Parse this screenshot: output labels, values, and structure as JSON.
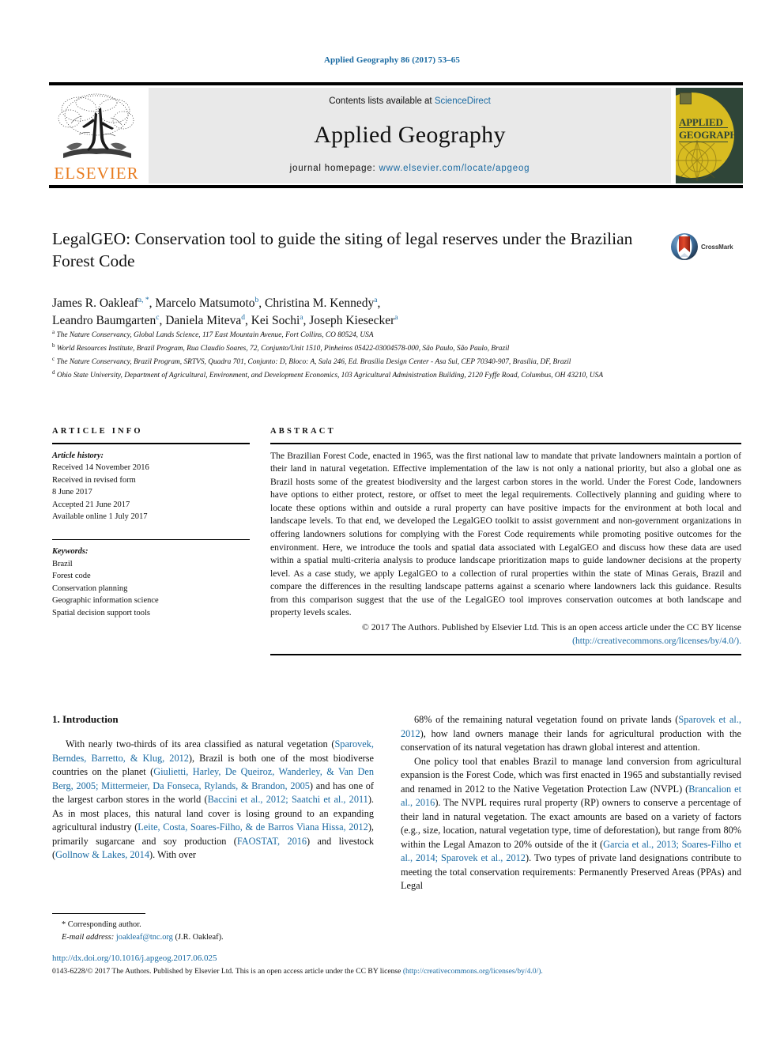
{
  "running_head": "Applied Geography 86 (2017) 53–65",
  "masthead": {
    "contents_prefix": "Contents lists available at ",
    "contents_link": "ScienceDirect",
    "journal_title": "Applied Geography",
    "homepage_prefix": "journal homepage: ",
    "homepage_url": "www.elsevier.com/locate/apgeog",
    "publisher_name": "ELSEVIER",
    "cover_line1": "APPLIED",
    "cover_line2": "GEOGRAPHY",
    "accent_color": "#1a6aa2",
    "elsevier_orange": "#e87b1e"
  },
  "article": {
    "title": "LegalGEO: Conservation tool to guide the siting of legal reserves under the Brazilian Forest Code",
    "crossmark_label": "CrossMark",
    "authors_line1": "James R. Oakleaf",
    "authors": [
      {
        "name": "James R. Oakleaf",
        "sup": "a, *"
      },
      {
        "name": "Marcelo Matsumoto",
        "sup": "b"
      },
      {
        "name": "Christina M. Kennedy",
        "sup": "a"
      },
      {
        "name": "Leandro Baumgarten",
        "sup": "c"
      },
      {
        "name": "Daniela Miteva",
        "sup": "d"
      },
      {
        "name": "Kei Sochi",
        "sup": "a"
      },
      {
        "name": "Joseph Kiesecker",
        "sup": "a"
      }
    ],
    "affiliations": [
      {
        "sup": "a",
        "text": "The Nature Conservancy, Global Lands Science, 117 East Mountain Avenue, Fort Collins, CO 80524, USA"
      },
      {
        "sup": "b",
        "text": "World Resources Institute, Brazil Program, Rua Claudio Soares, 72, Conjunto/Unit 1510, Pinheiros 05422-03004578-000, São Paulo, São Paulo, Brazil"
      },
      {
        "sup": "c",
        "text": "The Nature Conservancy, Brazil Program, SRTVS, Quadra 701, Conjunto: D, Bloco: A, Sala 246, Ed. Brasília Design Center - Asa Sul, CEP 70340-907, Brasília, DF, Brazil"
      },
      {
        "sup": "d",
        "text": "Ohio State University, Department of Agricultural, Environment, and Development Economics, 103 Agricultural Administration Building, 2120 Fyffe Road, Columbus, OH 43210, USA"
      }
    ]
  },
  "article_info": {
    "label": "ARTICLE INFO",
    "history_head": "Article history:",
    "history": [
      "Received 14 November 2016",
      "Received in revised form",
      "8 June 2017",
      "Accepted 21 June 2017",
      "Available online 1 July 2017"
    ],
    "keywords_head": "Keywords:",
    "keywords": [
      "Brazil",
      "Forest code",
      "Conservation planning",
      "Geographic information science",
      "Spatial decision support tools"
    ]
  },
  "abstract": {
    "label": "ABSTRACT",
    "text": "The Brazilian Forest Code, enacted in 1965, was the first national law to mandate that private landowners maintain a portion of their land in natural vegetation. Effective implementation of the law is not only a national priority, but also a global one as Brazil hosts some of the greatest biodiversity and the largest carbon stores in the world. Under the Forest Code, landowners have options to either protect, restore, or offset to meet the legal requirements. Collectively planning and guiding where to locate these options within and outside a rural property can have positive impacts for the environment at both local and landscape levels. To that end, we developed the LegalGEO toolkit to assist government and non-government organizations in offering landowners solutions for complying with the Forest Code requirements while promoting positive outcomes for the environment. Here, we introduce the tools and spatial data associated with LegalGEO and discuss how these data are used within a spatial multi-criteria analysis to produce landscape prioritization maps to guide landowner decisions at the property level. As a case study, we apply LegalGEO to a collection of rural properties within the state of Minas Gerais, Brazil and compare the differences in the resulting landscape patterns against a scenario where landowners lack this guidance. Results from this comparison suggest that the use of the LegalGEO tool improves conservation outcomes at both landscape and property levels scales.",
    "copyright_prefix": "© 2017 The Authors. Published by Elsevier Ltd. This is an open access article under the CC BY license ",
    "copyright_link": "(http://creativecommons.org/licenses/by/4.0/)."
  },
  "body": {
    "section_heading": "1. Introduction",
    "left_paragraph_1_parts": [
      {
        "t": "With nearly two-thirds of its area classified as natural vegetation (",
        "ref": false
      },
      {
        "t": "Sparovek, Berndes, Barretto, & Klug, 2012",
        "ref": true
      },
      {
        "t": "), Brazil is both one of the most biodiverse countries on the planet (",
        "ref": false
      },
      {
        "t": "Giulietti, Harley, De Queiroz, Wanderley, & Van Den Berg, 2005; Mittermeier, Da Fonseca, Rylands, & Brandon, 2005",
        "ref": true
      },
      {
        "t": ") and has one of the largest carbon stores in the world (",
        "ref": false
      },
      {
        "t": "Baccini et al., 2012; Saatchi et al., 2011",
        "ref": true
      },
      {
        "t": "). As in most places, this natural land cover is losing ground to an expanding agricultural industry (",
        "ref": false
      },
      {
        "t": "Leite, Costa, Soares-Filho, & de Barros Viana Hissa, 2012",
        "ref": true
      },
      {
        "t": "), primarily sugarcane and soy production (",
        "ref": false
      },
      {
        "t": "FAOSTAT, 2016",
        "ref": true
      },
      {
        "t": ") and livestock (",
        "ref": false
      },
      {
        "t": "Gollnow & Lakes, 2014",
        "ref": true
      },
      {
        "t": "). With over",
        "ref": false
      }
    ],
    "right_paragraph_1_parts": [
      {
        "t": "68% of the remaining natural vegetation found on private lands (",
        "ref": false
      },
      {
        "t": "Sparovek et al., 2012",
        "ref": true
      },
      {
        "t": "), how land owners manage their lands for agricultural production with the conservation of its natural vegetation has drawn global interest and attention.",
        "ref": false
      }
    ],
    "right_paragraph_2_parts": [
      {
        "t": "One policy tool that enables Brazil to manage land conversion from agricultural expansion is the Forest Code, which was first enacted in 1965 and substantially revised and renamed in 2012 to the Native Vegetation Protection Law (NVPL) (",
        "ref": false
      },
      {
        "t": "Brancalion et al., 2016",
        "ref": true
      },
      {
        "t": "). The NVPL requires rural property (RP) owners to conserve a percentage of their land in natural vegetation. The exact amounts are based on a variety of factors (e.g., size, location, natural vegetation type, time of deforestation), but range from 80% within the Legal Amazon to 20% outside of the it (",
        "ref": false
      },
      {
        "t": "Garcia et al., 2013; Soares-Filho et al., 2014; Sparovek et al., 2012",
        "ref": true
      },
      {
        "t": "). Two types of private land designations contribute to meeting the total conservation requirements: Permanently Preserved Areas (PPAs) and Legal",
        "ref": false
      }
    ]
  },
  "footnote": {
    "corresponding": "* Corresponding author.",
    "email_label": "E-mail address:",
    "email": "joakleaf@tnc.org",
    "email_suffix": "(J.R. Oakleaf)."
  },
  "page_footer": {
    "doi": "http://dx.doi.org/10.1016/j.apgeog.2017.06.025",
    "issn_prefix": "0143-6228/© 2017 The Authors. Published by Elsevier Ltd. This is an open access article under the CC BY license ",
    "issn_link": "(http://creativecommons.org/licenses/by/4.0/)."
  }
}
